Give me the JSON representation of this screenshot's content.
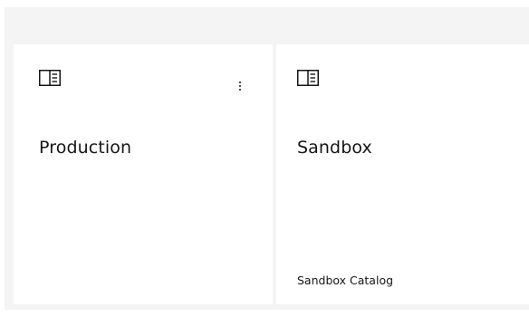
{
  "catalogs": [
    {
      "name": "Production",
      "description": "",
      "icon": "catalog-icon",
      "has_overflow_menu": true,
      "overflow_icon": "overflow-menu-vertical-icon"
    },
    {
      "name": "Sandbox",
      "description": "Sandbox Catalog",
      "icon": "catalog-icon",
      "has_overflow_menu": false
    }
  ],
  "colors": {
    "panel_background": "#f4f4f4",
    "tile_background": "#ffffff",
    "text": "#161616"
  }
}
